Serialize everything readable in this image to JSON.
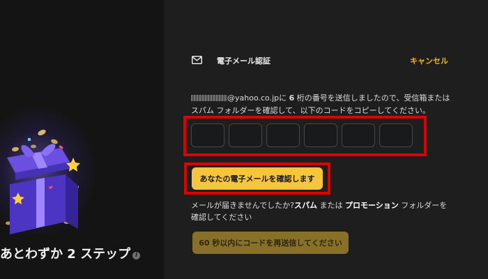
{
  "left": {
    "steps_prefix": "あとわずか",
    "steps_count": "2",
    "steps_suffix": "ステップ",
    "info_glyph": "i",
    "icon": "gift-icon"
  },
  "dialog": {
    "icon": "mail-icon",
    "title": "電子メール認証",
    "cancel_label": "キャンセル"
  },
  "description": {
    "email_domain": "@yahoo.co.jp",
    "ni": "に",
    "digits": "6",
    "line1_rest": "桁の番号を送信しましたので、受信箱または",
    "line2": "スパム フォルダーを確認して、以下のコードをコピーしてください。"
  },
  "code_inputs": [
    "",
    "",
    "",
    "",
    "",
    ""
  ],
  "confirm_button": "あなたの電子メールを確認します",
  "help": {
    "part1": "メールが届きませんでしたか?",
    "spam": "スパム",
    "part2": " または ",
    "promo": "プロモーション",
    "part3": " フォルダーを",
    "line2": "確認してください"
  },
  "resend_button": "60 秒以内にコードを再送信してください",
  "colors": {
    "background": "#1e1e1e",
    "accent": "#f0b90b",
    "button": "#f6c53c",
    "button_disabled": "#897028",
    "highlight": "#e10000"
  }
}
